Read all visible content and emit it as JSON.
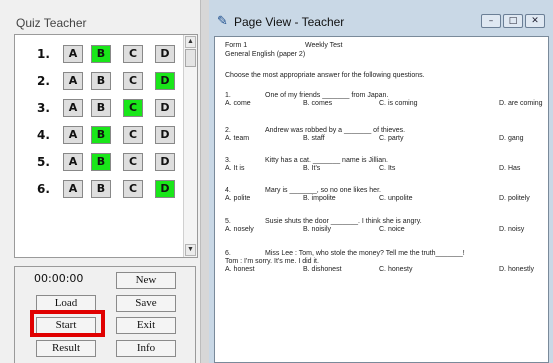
{
  "quiz_teacher": {
    "title": "Quiz Teacher",
    "questions": [
      {
        "num": "1.",
        "options": [
          "A",
          "B",
          "C",
          "D"
        ],
        "selected": "B"
      },
      {
        "num": "2.",
        "options": [
          "A",
          "B",
          "C",
          "D"
        ],
        "selected": "D"
      },
      {
        "num": "3.",
        "options": [
          "A",
          "B",
          "C",
          "D"
        ],
        "selected": "C"
      },
      {
        "num": "4.",
        "options": [
          "A",
          "B",
          "C",
          "D"
        ],
        "selected": "B"
      },
      {
        "num": "5.",
        "options": [
          "A",
          "B",
          "C",
          "D"
        ],
        "selected": "B"
      },
      {
        "num": "6.",
        "options": [
          "A",
          "B",
          "C",
          "D"
        ],
        "selected": "D"
      }
    ],
    "timer": "00:00:00",
    "buttons": {
      "new": "New",
      "load": "Load",
      "save": "Save",
      "start": "Start",
      "exit": "Exit",
      "result": "Result",
      "info": "Info"
    },
    "scroll_up": "▲",
    "scroll_down": "▼"
  },
  "page_view": {
    "title": "Page View - Teacher",
    "window_buttons": {
      "minimize": "–",
      "maximize": "□",
      "close": "✕"
    },
    "header": {
      "form": "Form 1",
      "test": "Weekly Test",
      "subject": "General English (paper 2)",
      "instruction": "Choose the most appropriate answer for the following questions."
    },
    "questions": [
      {
        "num": "1.",
        "stem": "One of my friends _______ from Japan.",
        "extra": "",
        "choices": [
          "A. come",
          "B. comes",
          "C. is coming",
          "D. are coming"
        ]
      },
      {
        "num": "2.",
        "stem": "Andrew was robbed by a _______ of thieves.",
        "extra": "",
        "choices": [
          "A. team",
          "B. staff",
          "C. party",
          "D. gang"
        ]
      },
      {
        "num": "3.",
        "stem": "Kitty has a cat. _______ name is Jillian.",
        "extra": "",
        "choices": [
          "A. It is",
          "B. It's",
          "C. Its",
          "D. Has"
        ]
      },
      {
        "num": "4.",
        "stem": "Mary is _______, so no one likes her.",
        "extra": "",
        "choices": [
          "A. polite",
          "B. impolite",
          "C. unpolite",
          "D. politely"
        ]
      },
      {
        "num": "5.",
        "stem": "Susie shuts the door _______. I think she is angry.",
        "extra": "",
        "choices": [
          "A. nosely",
          "B. noisily",
          "C. noice",
          "D. noisy"
        ]
      },
      {
        "num": "6.",
        "stem": "Miss Lee :          Tom, who stole the money? Tell me the truth_______!",
        "extra": "Tom :                    I'm sorry. It's me. I did it.",
        "choices": [
          "A. honest",
          "B. dishonest",
          "C. honesty",
          "D. honestly"
        ]
      }
    ]
  }
}
